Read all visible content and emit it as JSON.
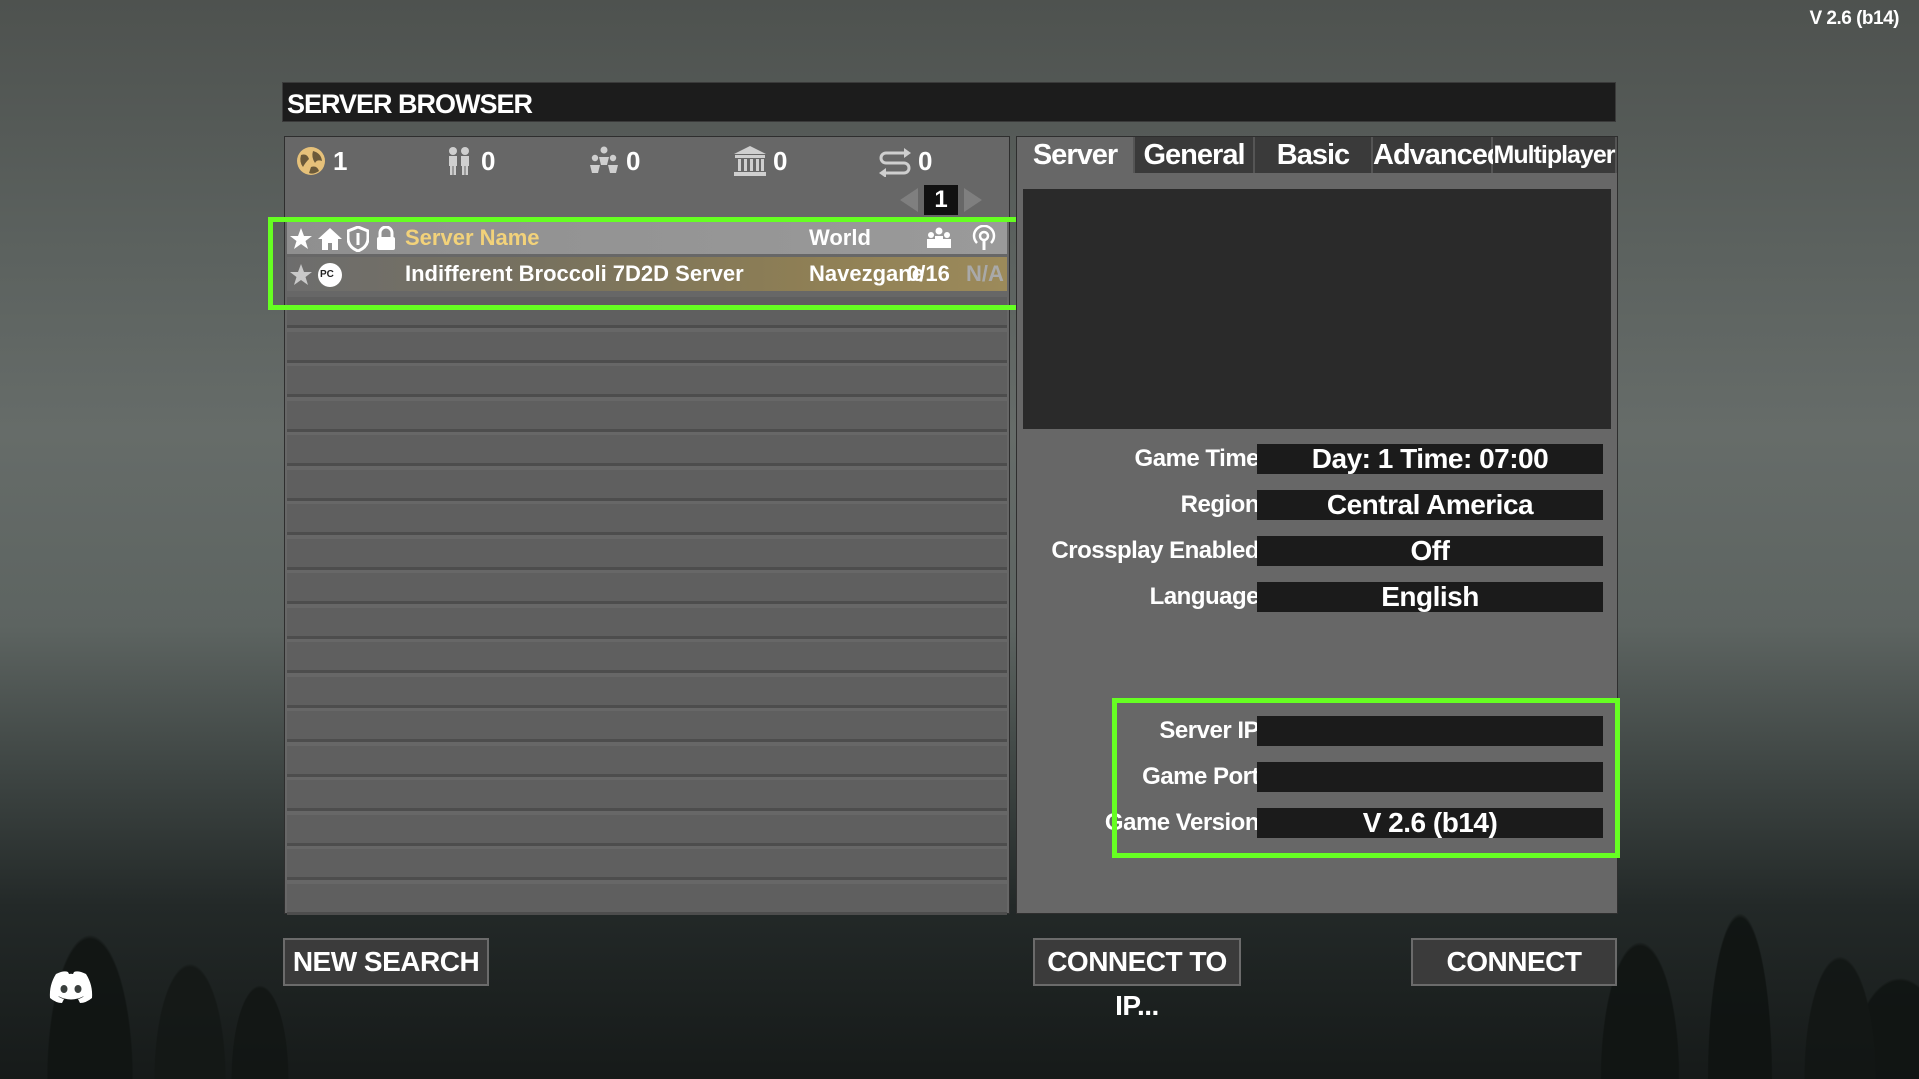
{
  "version_label": "V 2.6 (b14)",
  "window_title": "SERVER BROWSER",
  "filters": [
    {
      "icon": "globe-icon",
      "count": "1"
    },
    {
      "icon": "friends-icon",
      "count": "0"
    },
    {
      "icon": "group-icon",
      "count": "0"
    },
    {
      "icon": "lan-building-icon",
      "count": "0"
    },
    {
      "icon": "history-icon",
      "count": "0"
    }
  ],
  "pager": {
    "page": "1"
  },
  "list_header": {
    "name": "Server Name",
    "world": "World"
  },
  "servers": [
    {
      "platform": "PC",
      "name": "Indifferent Broccoli 7D2D Server",
      "world": "Navezgane",
      "players": "0/16",
      "ping": "N/A"
    }
  ],
  "tabs": [
    "Server",
    "General",
    "Basic",
    "Advanced",
    "Multiplayer"
  ],
  "active_tab": "Server",
  "info": {
    "game_time_label": "Game Time",
    "game_time": "Day: 1 Time: 07:00",
    "region_label": "Region",
    "region": "Central America",
    "crossplay_label": "Crossplay Enabled",
    "crossplay": "Off",
    "language_label": "Language",
    "language": "English",
    "server_ip_label": "Server IP",
    "server_ip": "",
    "game_port_label": "Game Port",
    "game_port": "",
    "game_version_label": "Game Version",
    "game_version": "V 2.6 (b14)"
  },
  "buttons": {
    "new_search": "NEW SEARCH",
    "connect_to_ip": "CONNECT TO IP...",
    "connect": "CONNECT"
  },
  "colors": {
    "highlight": "#66ff22",
    "header_text": "#f2d27a",
    "ping_text": "#a9a9a9"
  }
}
